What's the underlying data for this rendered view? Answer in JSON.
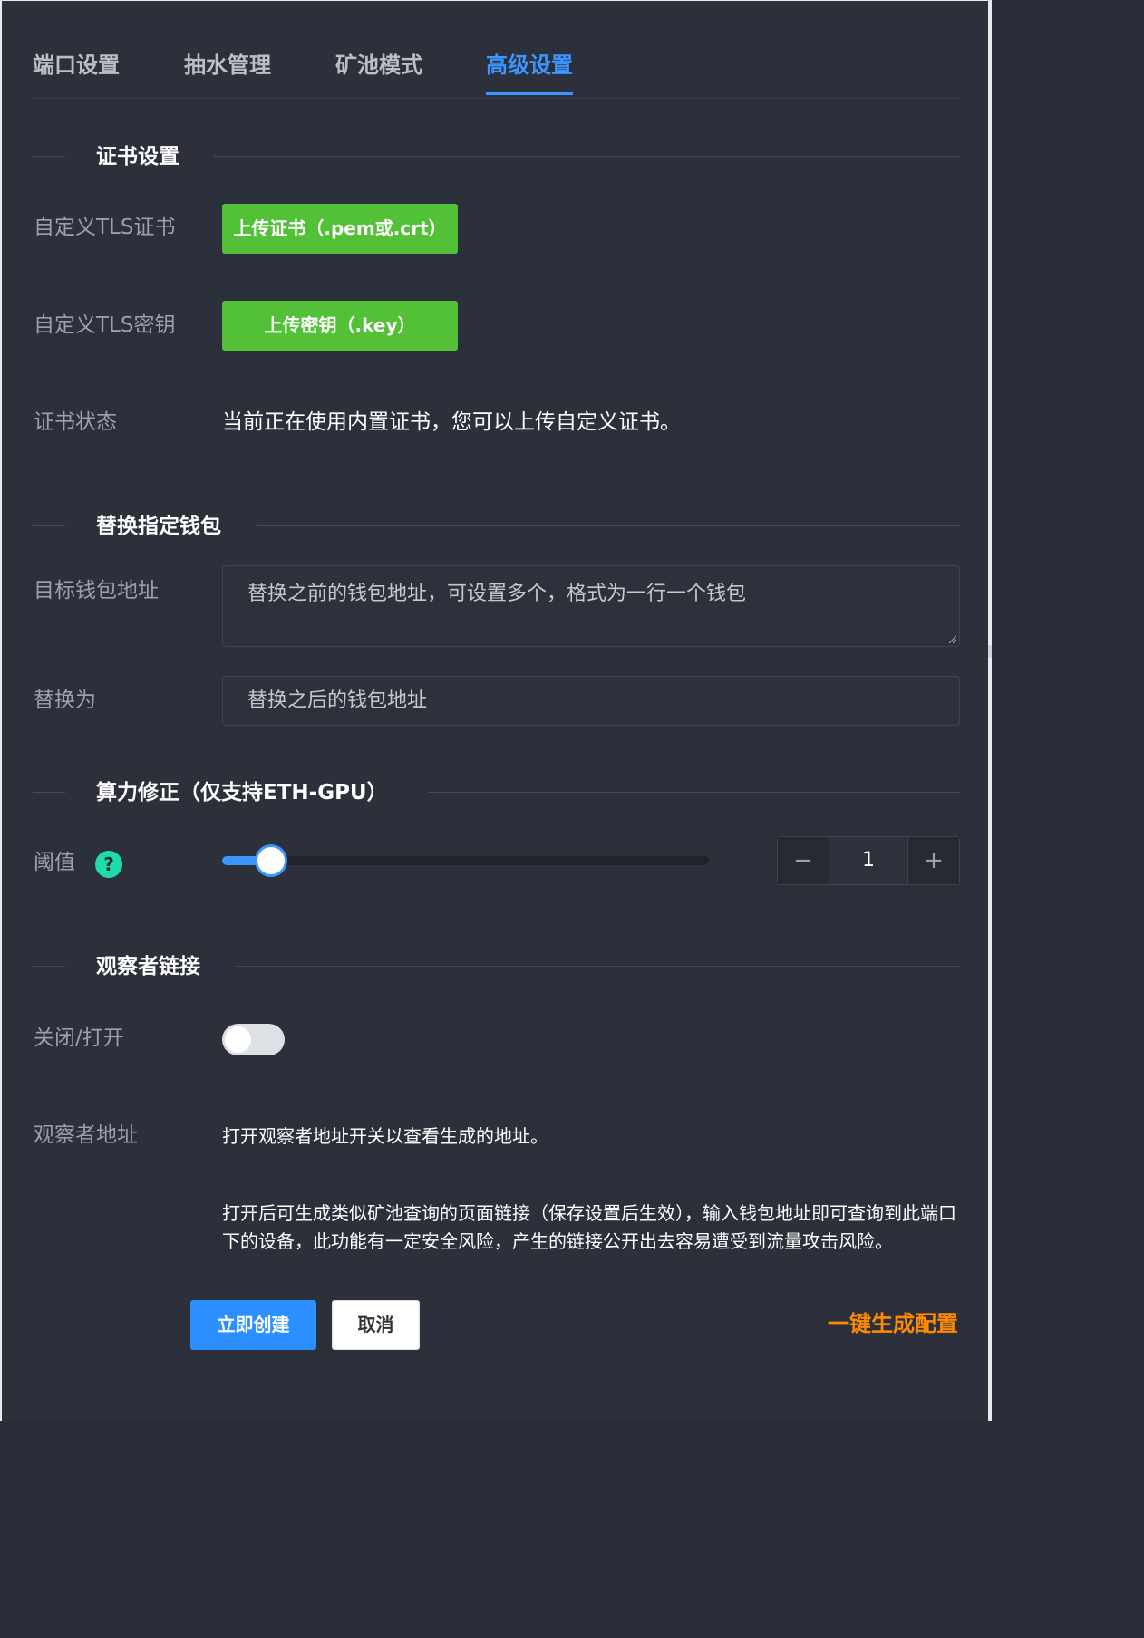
{
  "tabs": [
    {
      "label": "端口设置"
    },
    {
      "label": "抽水管理"
    },
    {
      "label": "矿池模式"
    },
    {
      "label": "高级设置",
      "active": true
    }
  ],
  "cert_section": {
    "title": "证书设置",
    "tls_cert_label": "自定义TLS证书",
    "tls_cert_button": "上传证书（.pem或.crt）",
    "tls_key_label": "自定义TLS密钥",
    "tls_key_button": "上传密钥（.key）",
    "status_label": "证书状态",
    "status_text": "当前正在使用内置证书，您可以上传自定义证书。"
  },
  "wallet_section": {
    "title": "替换指定钱包",
    "target_label": "目标钱包地址",
    "target_placeholder": "替换之前的钱包地址，可设置多个，格式为一行一个钱包",
    "replace_label": "替换为",
    "replace_placeholder": "替换之后的钱包地址"
  },
  "hashrate_section": {
    "title": "算力修正（仅支持ETH-GPU）",
    "threshold_label": "阈值",
    "help_icon_glyph": "?",
    "slider_fraction": 0.1,
    "stepper": {
      "minus": "−",
      "value": "1",
      "plus": "+"
    }
  },
  "observer_section": {
    "title": "观察者链接",
    "toggle_label": "关闭/打开",
    "toggle_on": false,
    "address_label": "观察者地址",
    "address_text": "打开观察者地址开关以查看生成的地址。",
    "note_text": "打开后可生成类似矿池查询的页面链接（保存设置后生效），输入钱包地址即可查询到此端口下的设备，此功能有一定安全风险，产生的链接公开出去容易遭受到流量攻击风险。"
  },
  "footer": {
    "create_button": "立即创建",
    "cancel_button": "取消",
    "generate_link": "一键生成配置"
  },
  "colors": {
    "accent": "#3d95ff",
    "green": "#52c137",
    "orange": "#ff8a00",
    "help": "#1fdcb0",
    "background": "#2b303b"
  }
}
